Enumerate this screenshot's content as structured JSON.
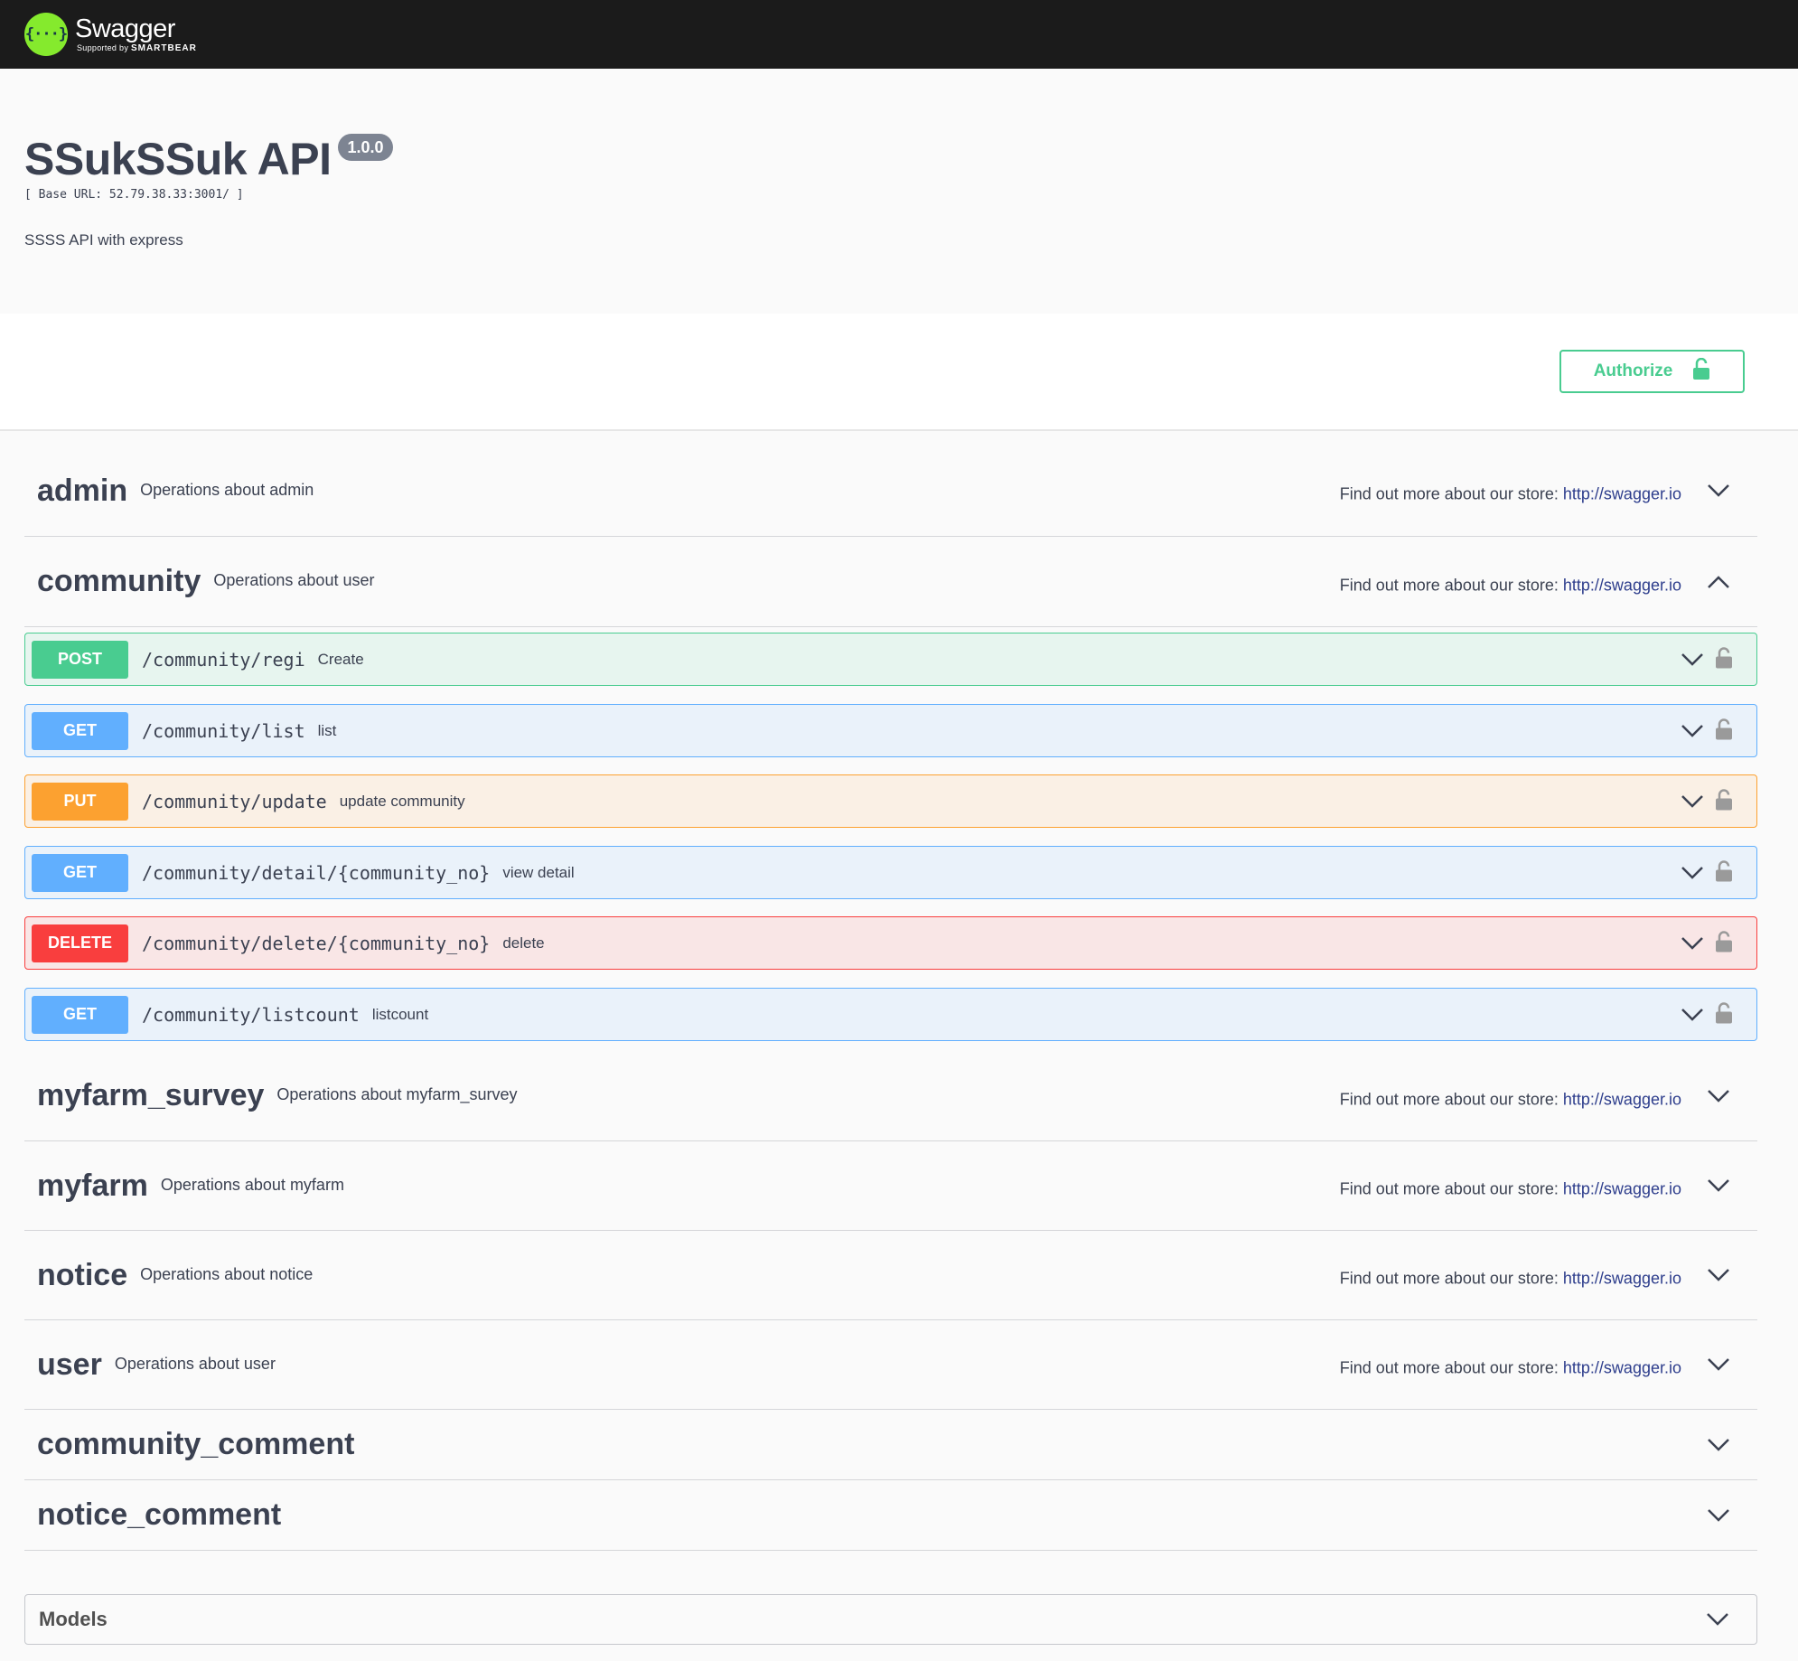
{
  "topbar": {
    "logo_mark": "{···}",
    "logo_name": "Swagger",
    "logo_sub_prefix": "Supported by",
    "logo_sub_brand": "SMARTBEAR"
  },
  "info": {
    "title": "SSukSSuk API",
    "version": "1.0.0",
    "base_url": "[ Base URL: 52.79.38.33:3001/ ]",
    "description": "SSSS API with express"
  },
  "authorize": {
    "label": "Authorize",
    "icon": "unlocked-lock-icon",
    "color": "#49cc90"
  },
  "colors": {
    "post": "#49cc90",
    "get": "#61affe",
    "put": "#fca130",
    "delete": "#f93e3e"
  },
  "tags": [
    {
      "name": "admin",
      "description": "Operations about admin",
      "ext_text": "Find out more about our store:",
      "ext_link": "http://swagger.io",
      "expanded": false
    },
    {
      "name": "community",
      "description": "Operations about user",
      "ext_text": "Find out more about our store:",
      "ext_link": "http://swagger.io",
      "expanded": true
    },
    {
      "name": "myfarm_survey",
      "description": "Operations about myfarm_survey",
      "ext_text": "Find out more about our store:",
      "ext_link": "http://swagger.io",
      "expanded": false
    },
    {
      "name": "myfarm",
      "description": "Operations about myfarm",
      "ext_text": "Find out more about our store:",
      "ext_link": "http://swagger.io",
      "expanded": false
    },
    {
      "name": "notice",
      "description": "Operations about notice",
      "ext_text": "Find out more about our store:",
      "ext_link": "http://swagger.io",
      "expanded": false
    },
    {
      "name": "user",
      "description": "Operations about user",
      "ext_text": "Find out more about our store:",
      "ext_link": "http://swagger.io",
      "expanded": false
    },
    {
      "name": "community_comment"
    },
    {
      "name": "notice_comment"
    }
  ],
  "operations": [
    {
      "method": "POST",
      "path": "/community/regi",
      "summary": "Create"
    },
    {
      "method": "GET",
      "path": "/community/list",
      "summary": "list"
    },
    {
      "method": "PUT",
      "path": "/community/update",
      "summary": "update community"
    },
    {
      "method": "GET",
      "path": "/community/detail/{community_no}",
      "summary": "view detail"
    },
    {
      "method": "DELETE",
      "path": "/community/delete/{community_no}",
      "summary": "delete"
    },
    {
      "method": "GET",
      "path": "/community/listcount",
      "summary": "listcount"
    }
  ],
  "models": {
    "title": "Models"
  }
}
